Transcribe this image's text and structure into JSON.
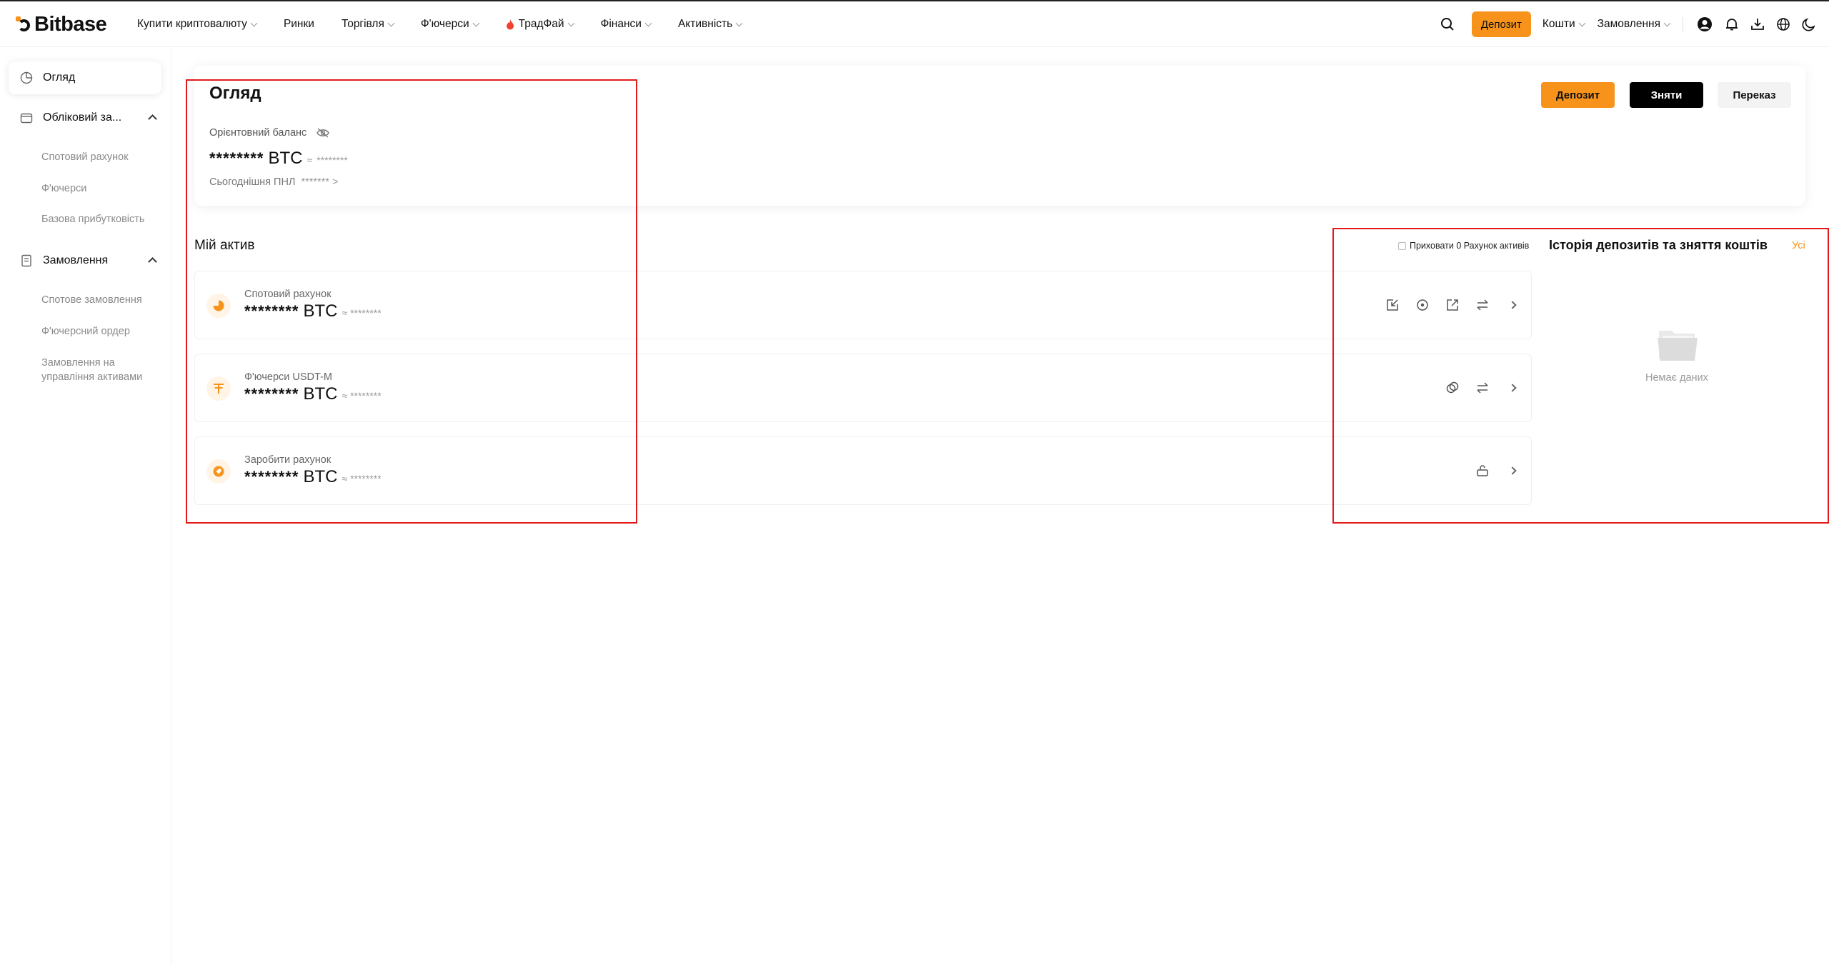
{
  "header": {
    "logo": "Bitbase",
    "nav": [
      {
        "label": "Купити криптовалюту",
        "dropdown": true
      },
      {
        "label": "Ринки",
        "dropdown": false
      },
      {
        "label": "Торгівля",
        "dropdown": true
      },
      {
        "label": "Ф'ючерси",
        "dropdown": true
      },
      {
        "label": "ТрадФай",
        "dropdown": true,
        "icon": "fire-icon"
      },
      {
        "label": "Фінанси",
        "dropdown": true
      },
      {
        "label": "Активність",
        "dropdown": true
      }
    ],
    "deposit_label": "Депозит",
    "funds_label": "Кошти",
    "orders_label": "Замовлення"
  },
  "sidebar": {
    "active": "Огляд",
    "account_group": "Обліковий за...",
    "account_items": [
      "Спотовий рахунок",
      "Ф'ючерси",
      "Базова прибутковість"
    ],
    "orders_group": "Замовлення",
    "orders_items": [
      "Спотове замовлення",
      "Ф'ючерсний ордер",
      "Замовлення на управління активами"
    ]
  },
  "overview": {
    "title": "Огляд",
    "est_balance_label": "Орієнтовний баланс",
    "balance_hidden": "********",
    "coin": "BTC",
    "approx_symbol": "≈",
    "approx_hidden": "********",
    "pnl_label": "Сьогоднішня ПНЛ",
    "pnl_value": "******* >",
    "buttons": {
      "deposit": "Депозит",
      "withdraw": "Зняти",
      "transfer": "Переказ"
    }
  },
  "assets": {
    "title": "Мій актив",
    "hide_zero_label": "Приховати 0 Рахунок активів",
    "rows": [
      {
        "name": "Спотовий рахунок",
        "value": "********",
        "coin": "BTC",
        "approx": "≈ ********"
      },
      {
        "name": "Ф'ючерси USDT-M",
        "value": "********",
        "coin": "BTC",
        "approx": "≈ ********"
      },
      {
        "name": "Заробити рахунок",
        "value": "********",
        "coin": "BTC",
        "approx": "≈ ********"
      }
    ]
  },
  "history": {
    "title": "Історія депозитів та зняття коштів",
    "all_label": "Усі",
    "empty_label": "Немає даних"
  },
  "colors": {
    "accent": "#f7931a",
    "highlight_box": "#e21a1a"
  }
}
